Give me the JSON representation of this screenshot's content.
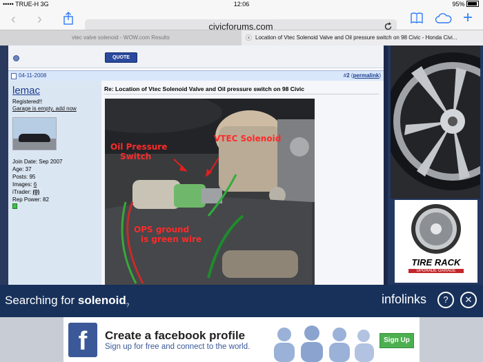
{
  "status": {
    "carrier": "••••• TRUE-H  3G",
    "time": "12:06",
    "battery": "95%"
  },
  "browser": {
    "url": "civicforums.com"
  },
  "tabs": [
    {
      "title": "vtec valve solenoid - WOW.com Results"
    },
    {
      "title": "Location of Vtec Solenoid Valve and Oil pressure switch on 98 Civic - Honda Civi..."
    }
  ],
  "quote_button": "QUOTE",
  "post": {
    "date": "04-11-2008",
    "number_prefix": "#",
    "number": "2",
    "permalink": "permalink",
    "title": "Re: Location of Vtec Solenoid Valve and Oil pressure switch on 98 Civic",
    "photo_labels": {
      "oil_pressure": "Oil Pressure\nSwitch",
      "vtec": "VTEC Solenoid",
      "ops_ground": "OPS ground\nis green wire"
    }
  },
  "user": {
    "name": "lemac",
    "rank": "Registered!!",
    "garage": "Garage is empty, add now",
    "join_date": "Join Date: Sep 2007",
    "age": "Age: 37",
    "posts": "Posts: 95",
    "images_label": "Images:",
    "images": "6",
    "itrader_label": "iTrader:",
    "itrader": "(0)",
    "rep": "Rep Power: 82"
  },
  "infolinks": {
    "prefix": "Searching for",
    "term": "solenoid",
    "brand": "infolinks"
  },
  "ads": {
    "tirerack": "TIRE RACK",
    "tirerack_sub": "UPGRADE GARAGE",
    "fb_title": "Create a facebook profile",
    "fb_sub": "Sign up for free and connect to the world.",
    "fb_button": "Sign Up"
  },
  "colors": {
    "link": "#1b3d8f",
    "infobar": "#18315a",
    "fb": "#3b5998",
    "signup": "#4caf50"
  }
}
